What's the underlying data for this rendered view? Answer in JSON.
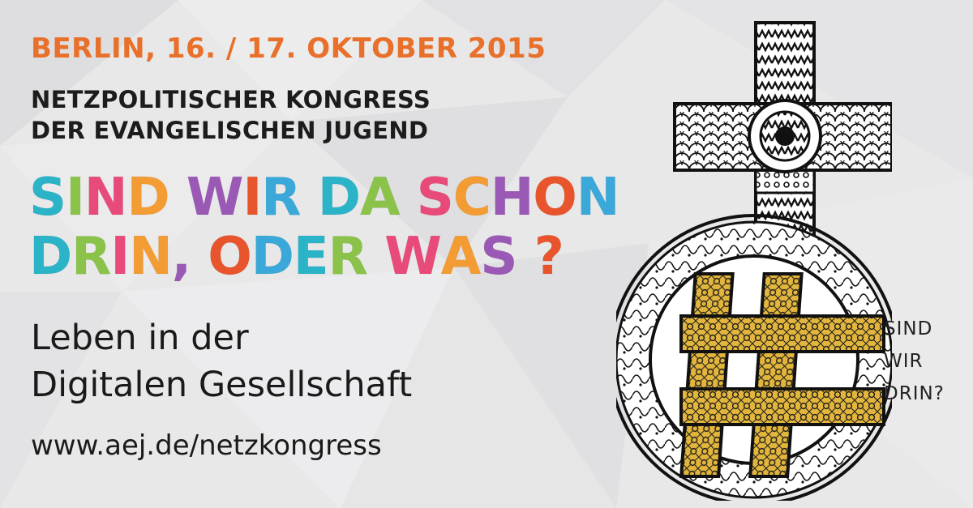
{
  "header": {
    "date": "BERLIN, 16. / 17. OKTOBER 2015",
    "subtitle_line1": "NETZPOLITISCHER KONGRESS",
    "subtitle_line2": "DER EVANGELISCHEN JUGEND"
  },
  "headline": {
    "line1": "SIND WIR DA SCHON",
    "line2": "DRIN, ODER WAS ?",
    "palette": [
      "#2bb3c7",
      "#8bc34a",
      "#e84a7a",
      "#f39c33",
      "#9b59b6",
      "#e8552d",
      "#3aa8d8"
    ]
  },
  "tagline": {
    "line1": "Leben in der",
    "line2": "Digitalen Gesellschaft"
  },
  "link": {
    "url": "www.aej.de/netzkongress"
  },
  "emblem": {
    "icon": "cross-with-hashtag-emblem-icon",
    "side_text": [
      "SIND",
      "WIR",
      "DRIN?"
    ],
    "gold": "#e2b53c"
  }
}
